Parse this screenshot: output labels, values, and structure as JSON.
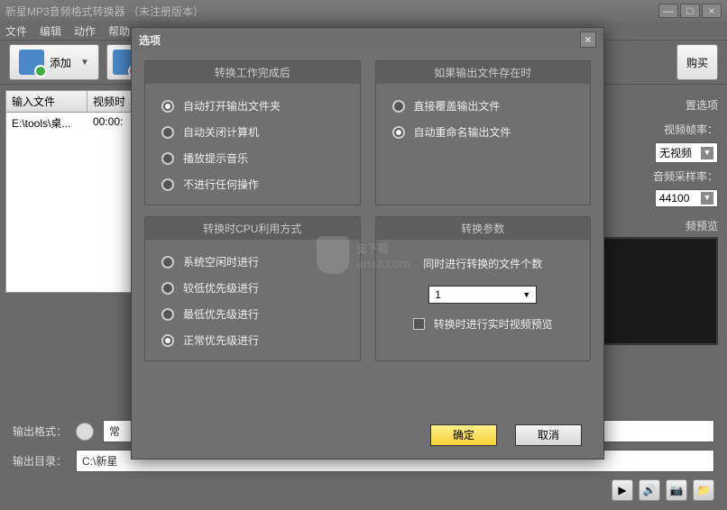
{
  "window": {
    "title": "新星MP3音频格式转换器 （未注册版本）"
  },
  "menu": {
    "file": "文件",
    "edit": "编辑",
    "action": "动作",
    "help": "帮助"
  },
  "toolbar": {
    "add": "添加",
    "buy": "购买"
  },
  "table": {
    "col_input": "输入文件",
    "col_video_time": "视频时",
    "rows": [
      {
        "input": "E:\\tools\\桌...",
        "time": "00:00:"
      }
    ]
  },
  "right_panel": {
    "settings_title": "置选项",
    "video_fps_label": "视频帧率：",
    "video_fps_value": "无视频",
    "audio_rate_label": "音频采样率：",
    "audio_rate_value": "44100",
    "preview_title": "频预览"
  },
  "bottom": {
    "output_format_label": "输出格式：",
    "output_format_value": "常",
    "output_dir_label": "输出目录：",
    "output_dir_value": "C:\\新星"
  },
  "dialog": {
    "title": "选项",
    "group1_title": "转换工作完成后",
    "g1_opt1": "自动打开输出文件夹",
    "g1_opt2": "自动关闭计算机",
    "g1_opt3": "播放提示音乐",
    "g1_opt4": "不进行任何操作",
    "group2_title": "如果输出文件存在时",
    "g2_opt1": "直接覆盖输出文件",
    "g2_opt2": "自动重命名输出文件",
    "group3_title": "转换时CPU利用方式",
    "g3_opt1": "系统空闲时进行",
    "g3_opt2": "较低优先级进行",
    "g3_opt3": "最低优先级进行",
    "g3_opt4": "正常优先级进行",
    "group4_title": "转换参数",
    "g4_label": "同时进行转换的文件个数",
    "g4_count": "1",
    "g4_check": "转换时进行实时视频预览",
    "ok": "确定",
    "cancel": "取消"
  },
  "watermark": {
    "main": "安下载",
    "sub": "anxz.com"
  }
}
